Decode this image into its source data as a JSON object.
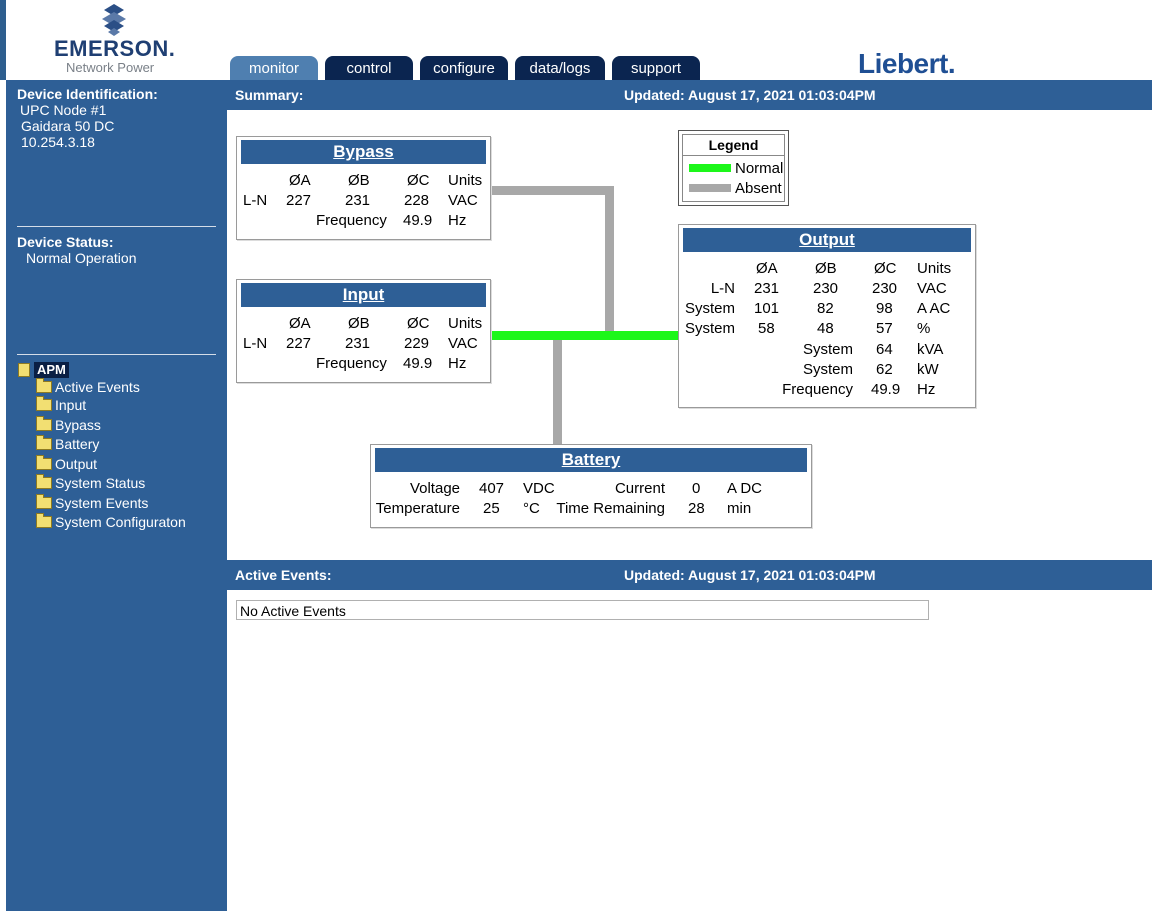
{
  "header": {
    "emerson_word": "EMERSON.",
    "emerson_sub": "Network Power",
    "liebert": "Liebert.",
    "tabs": [
      {
        "label": "monitor",
        "active": true
      },
      {
        "label": "control",
        "active": false
      },
      {
        "label": "configure",
        "active": false
      },
      {
        "label": "data/logs",
        "active": false
      },
      {
        "label": "support",
        "active": false
      }
    ]
  },
  "sidebar": {
    "device_id_heading": "Device Identification:",
    "device_name": "UPC Node #1",
    "device_model": "Gaidara 50 DC",
    "device_ip": "10.254.3.18",
    "status_heading": "Device Status:",
    "status_value": "Normal Operation",
    "tree_root": "APM",
    "tree_items": [
      "Active Events",
      "Input",
      "Bypass",
      "Battery",
      "Output",
      "System Status",
      "System Events",
      "System Configuraton"
    ]
  },
  "summary": {
    "label": "Summary:",
    "updated": "Updated: August 17, 2021 01:03:04PM"
  },
  "legend": {
    "title": "Legend",
    "normal": "Normal",
    "absent": "Absent",
    "normal_color": "#1df71a",
    "absent_color": "#a8a8a8"
  },
  "bypass": {
    "title": "Bypass",
    "headers": [
      "ØA",
      "ØB",
      "ØC",
      "Units"
    ],
    "row_label": "L-N",
    "values": [
      "227",
      "231",
      "228"
    ],
    "units": "VAC",
    "freq_label": "Frequency",
    "freq": "49.9",
    "freq_units": "Hz"
  },
  "input": {
    "title": "Input",
    "headers": [
      "ØA",
      "ØB",
      "ØC",
      "Units"
    ],
    "row_label": "L-N",
    "values": [
      "227",
      "231",
      "229"
    ],
    "units": "VAC",
    "freq_label": "Frequency",
    "freq": "49.9",
    "freq_units": "Hz"
  },
  "output": {
    "title": "Output",
    "headers": [
      "ØA",
      "ØB",
      "ØC",
      "Units"
    ],
    "rows": [
      {
        "label": "L-N",
        "a": "231",
        "b": "230",
        "c": "230",
        "units": "VAC"
      },
      {
        "label": "System",
        "a": "101",
        "b": "82",
        "c": "98",
        "units": "A AC"
      },
      {
        "label": "System",
        "a": "58",
        "b": "48",
        "c": "57",
        "units": "%"
      }
    ],
    "sys_rows": [
      {
        "label": "System",
        "value": "64",
        "units": "kVA"
      },
      {
        "label": "System",
        "value": "62",
        "units": "kW"
      },
      {
        "label": "Frequency",
        "value": "49.9",
        "units": "Hz"
      }
    ]
  },
  "battery": {
    "title": "Battery",
    "voltage_label": "Voltage",
    "voltage": "407",
    "voltage_units": "VDC",
    "current_label": "Current",
    "current": "0",
    "current_units": "A DC",
    "temp_label": "Temperature",
    "temp": "25",
    "temp_units": "°C",
    "remaining_label": "Time Remaining",
    "remaining": "28",
    "remaining_units": "min"
  },
  "events": {
    "label": "Active Events:",
    "updated": "Updated: August 17, 2021 01:03:04PM",
    "message": "No Active Events"
  }
}
